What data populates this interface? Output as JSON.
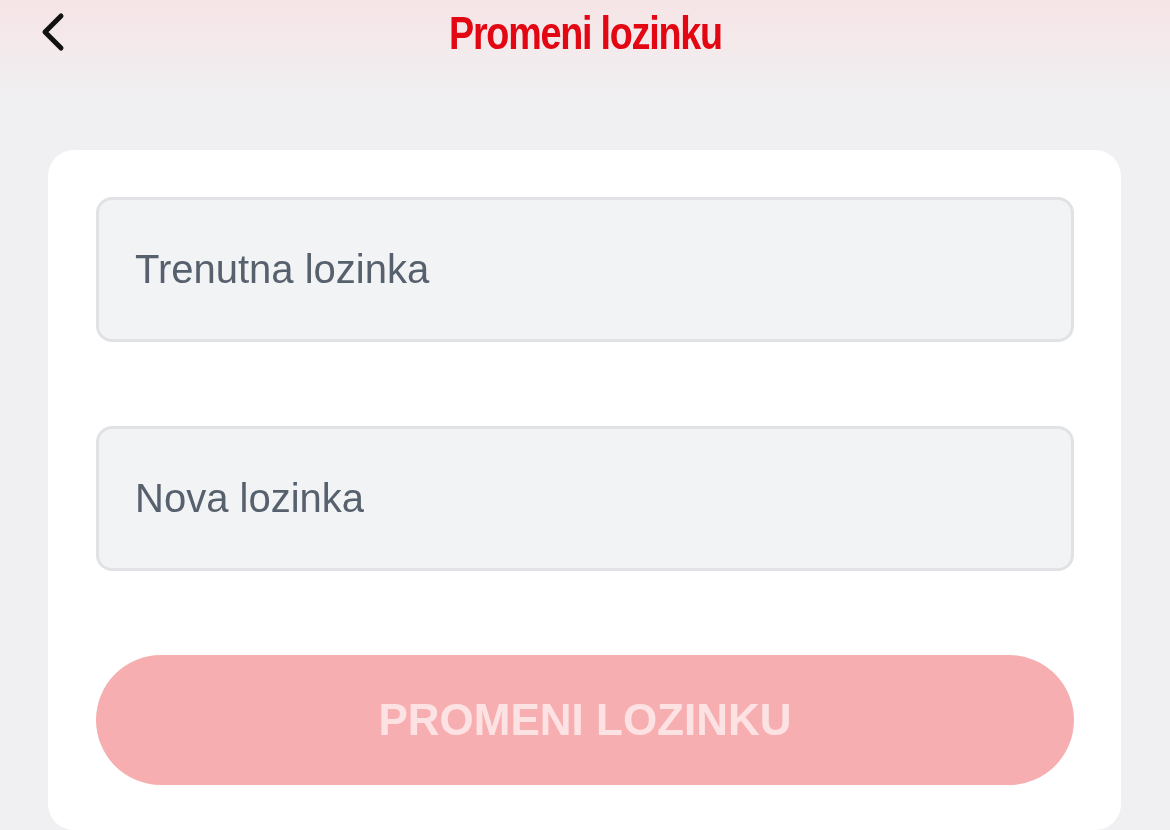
{
  "header": {
    "title": "Promeni lozinku"
  },
  "form": {
    "fields": [
      {
        "placeholder": "Trenutna lozinka"
      },
      {
        "placeholder": "Nova lozinka"
      }
    ],
    "button": {
      "label": "PROMENI LOZINKU",
      "disabled": true
    }
  }
}
